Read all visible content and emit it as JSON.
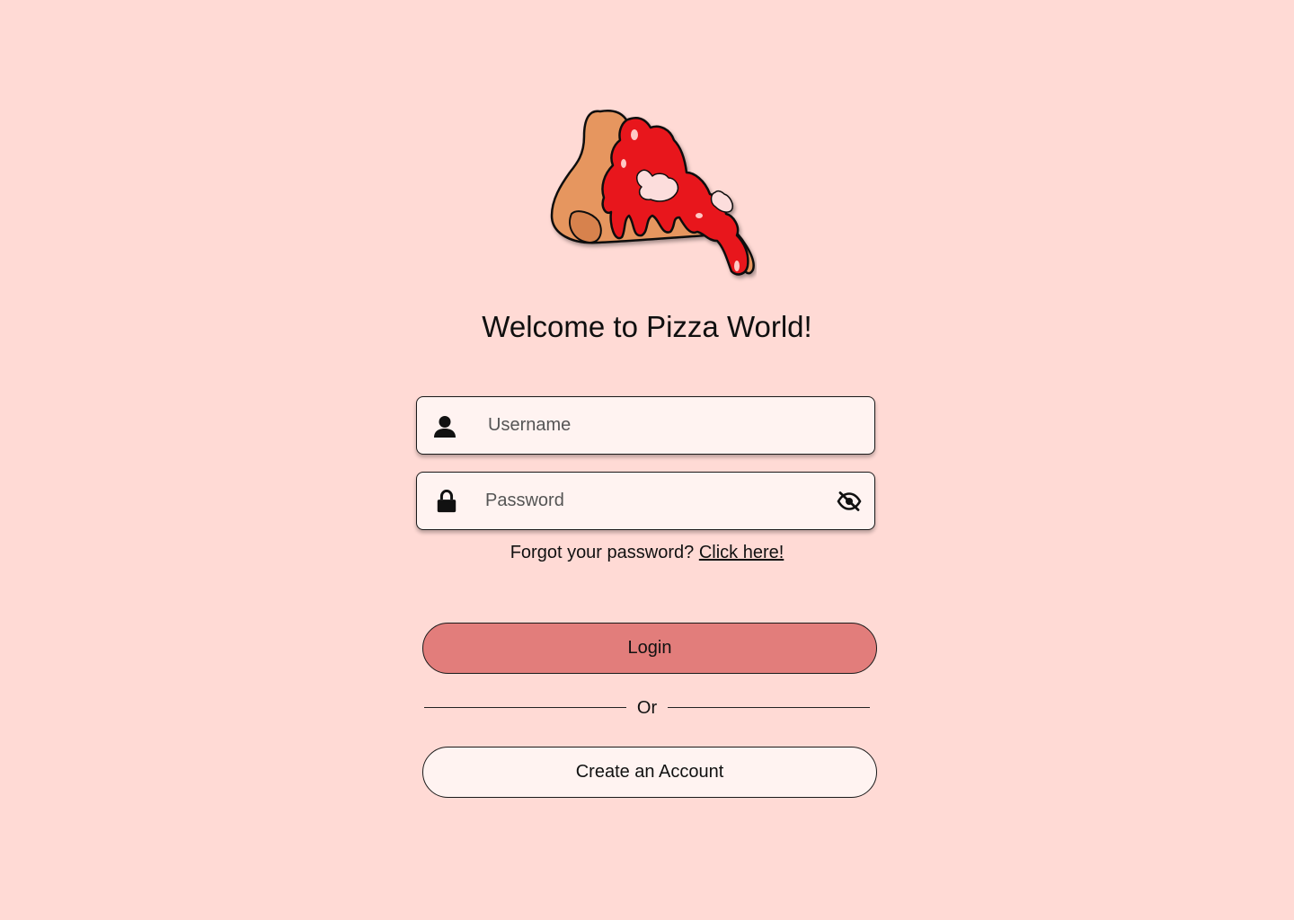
{
  "brand": {
    "logo_icon": "pizza-slice-icon",
    "title": "Welcome to Pizza World!"
  },
  "form": {
    "username": {
      "placeholder": "Username",
      "value": "",
      "icon": "user-icon"
    },
    "password": {
      "placeholder": "Password",
      "value": "",
      "icon": "lock-icon",
      "toggle_icon": "eye-off-icon"
    },
    "forgot": {
      "text": "Forgot your password?",
      "link_label": "Click here!"
    },
    "login_label": "Login",
    "divider_label": "Or",
    "create_account_label": "Create an Account"
  },
  "colors": {
    "background": "#FFDAD5",
    "field_bg": "#FFF3F1",
    "login_button": "#E27D7B",
    "secondary_button": "#FFF3F1"
  }
}
